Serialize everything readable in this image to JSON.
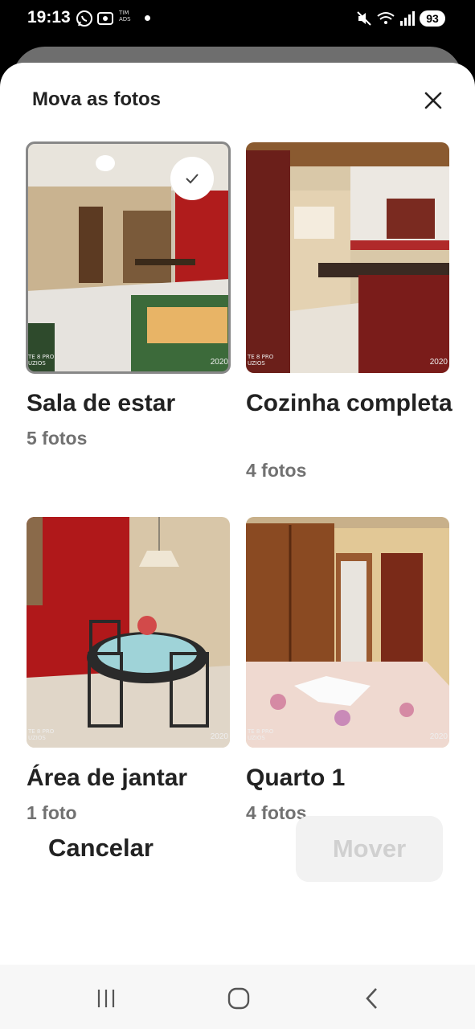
{
  "status_bar": {
    "time": "19:13",
    "carrier_badge": "TIM\nADS",
    "battery": "93",
    "icons": [
      "whatsapp-icon",
      "screenshot-icon",
      "mute-icon",
      "wifi-icon",
      "signal-icon",
      "battery-icon"
    ]
  },
  "sheet": {
    "title": "Mova as fotos",
    "close_icon": "close-icon"
  },
  "albums": [
    {
      "title": "Sala de estar",
      "count": "5 fotos",
      "selected": true
    },
    {
      "title": "Cozinha completa",
      "count": "4 fotos",
      "selected": false
    },
    {
      "title": "Área de jantar",
      "count": "1 foto",
      "selected": false
    },
    {
      "title": "Quarto 1",
      "count": "4 fotos",
      "selected": false
    }
  ],
  "photo_watermark": {
    "left": "TE 8 PRO\nUZIOS",
    "right": "2020"
  },
  "footer": {
    "cancel_label": "Cancelar",
    "move_label": "Mover"
  },
  "nav_bar": {
    "icons": [
      "recents-icon",
      "home-icon",
      "back-icon"
    ]
  },
  "colors": {
    "text_primary": "#222222",
    "text_secondary": "#717171",
    "disabled_button_bg": "#f2f2f2",
    "disabled_button_text": "#d0d0d0"
  }
}
